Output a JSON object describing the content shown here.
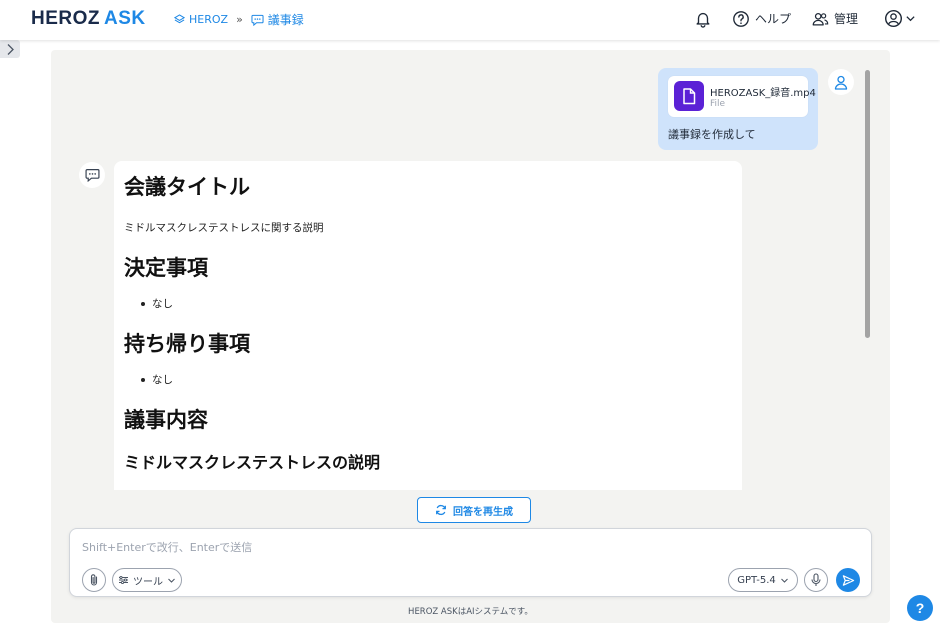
{
  "brand": {
    "name": "HEROZ",
    "suffix": "ASK"
  },
  "breadcrumb": {
    "workspace": "HEROZ",
    "separator": "»",
    "page": "議事録"
  },
  "header": {
    "help_label": "ヘルプ",
    "admin_label": "管理"
  },
  "conversation": {
    "user_message": {
      "file_name": "HEROZASK_録音.mp4",
      "file_type": "File",
      "text": "議事録を作成して"
    },
    "assistant_message": {
      "title": "会議タイトル",
      "title_desc": "ミドルマスクレステストレスに関する説明",
      "decisions_heading": "決定事項",
      "decisions": [
        "なし"
      ],
      "takeaways_heading": "持ち帰り事項",
      "takeaways": [
        "なし"
      ],
      "minutes_heading": "議事内容",
      "minutes_subheading": "ミドルマスクレステストレスの説明"
    },
    "regenerate_label": "回答を再生成"
  },
  "composer": {
    "placeholder": "Shift+Enterで改行、Enterで送信",
    "value": "",
    "tools_label": "ツール",
    "model_label": "GPT-5.4"
  },
  "footer_note": "HEROZ ASKはAIシステムです。",
  "help_fab_label": "?",
  "colors": {
    "accent": "#1e88e5",
    "brand_dark": "#1a2b4a",
    "file_icon": "#5b21d6",
    "user_bubble": "#cfe3fb",
    "panel": "#f3f3f1"
  },
  "icons": [
    "bell-icon",
    "help-circle-icon",
    "users-icon",
    "account-icon",
    "chevron-down-icon",
    "chevron-right-icon",
    "file-icon",
    "user-icon",
    "chat-icon",
    "refresh-icon",
    "paperclip-icon",
    "sliders-icon",
    "mic-icon",
    "send-icon"
  ]
}
